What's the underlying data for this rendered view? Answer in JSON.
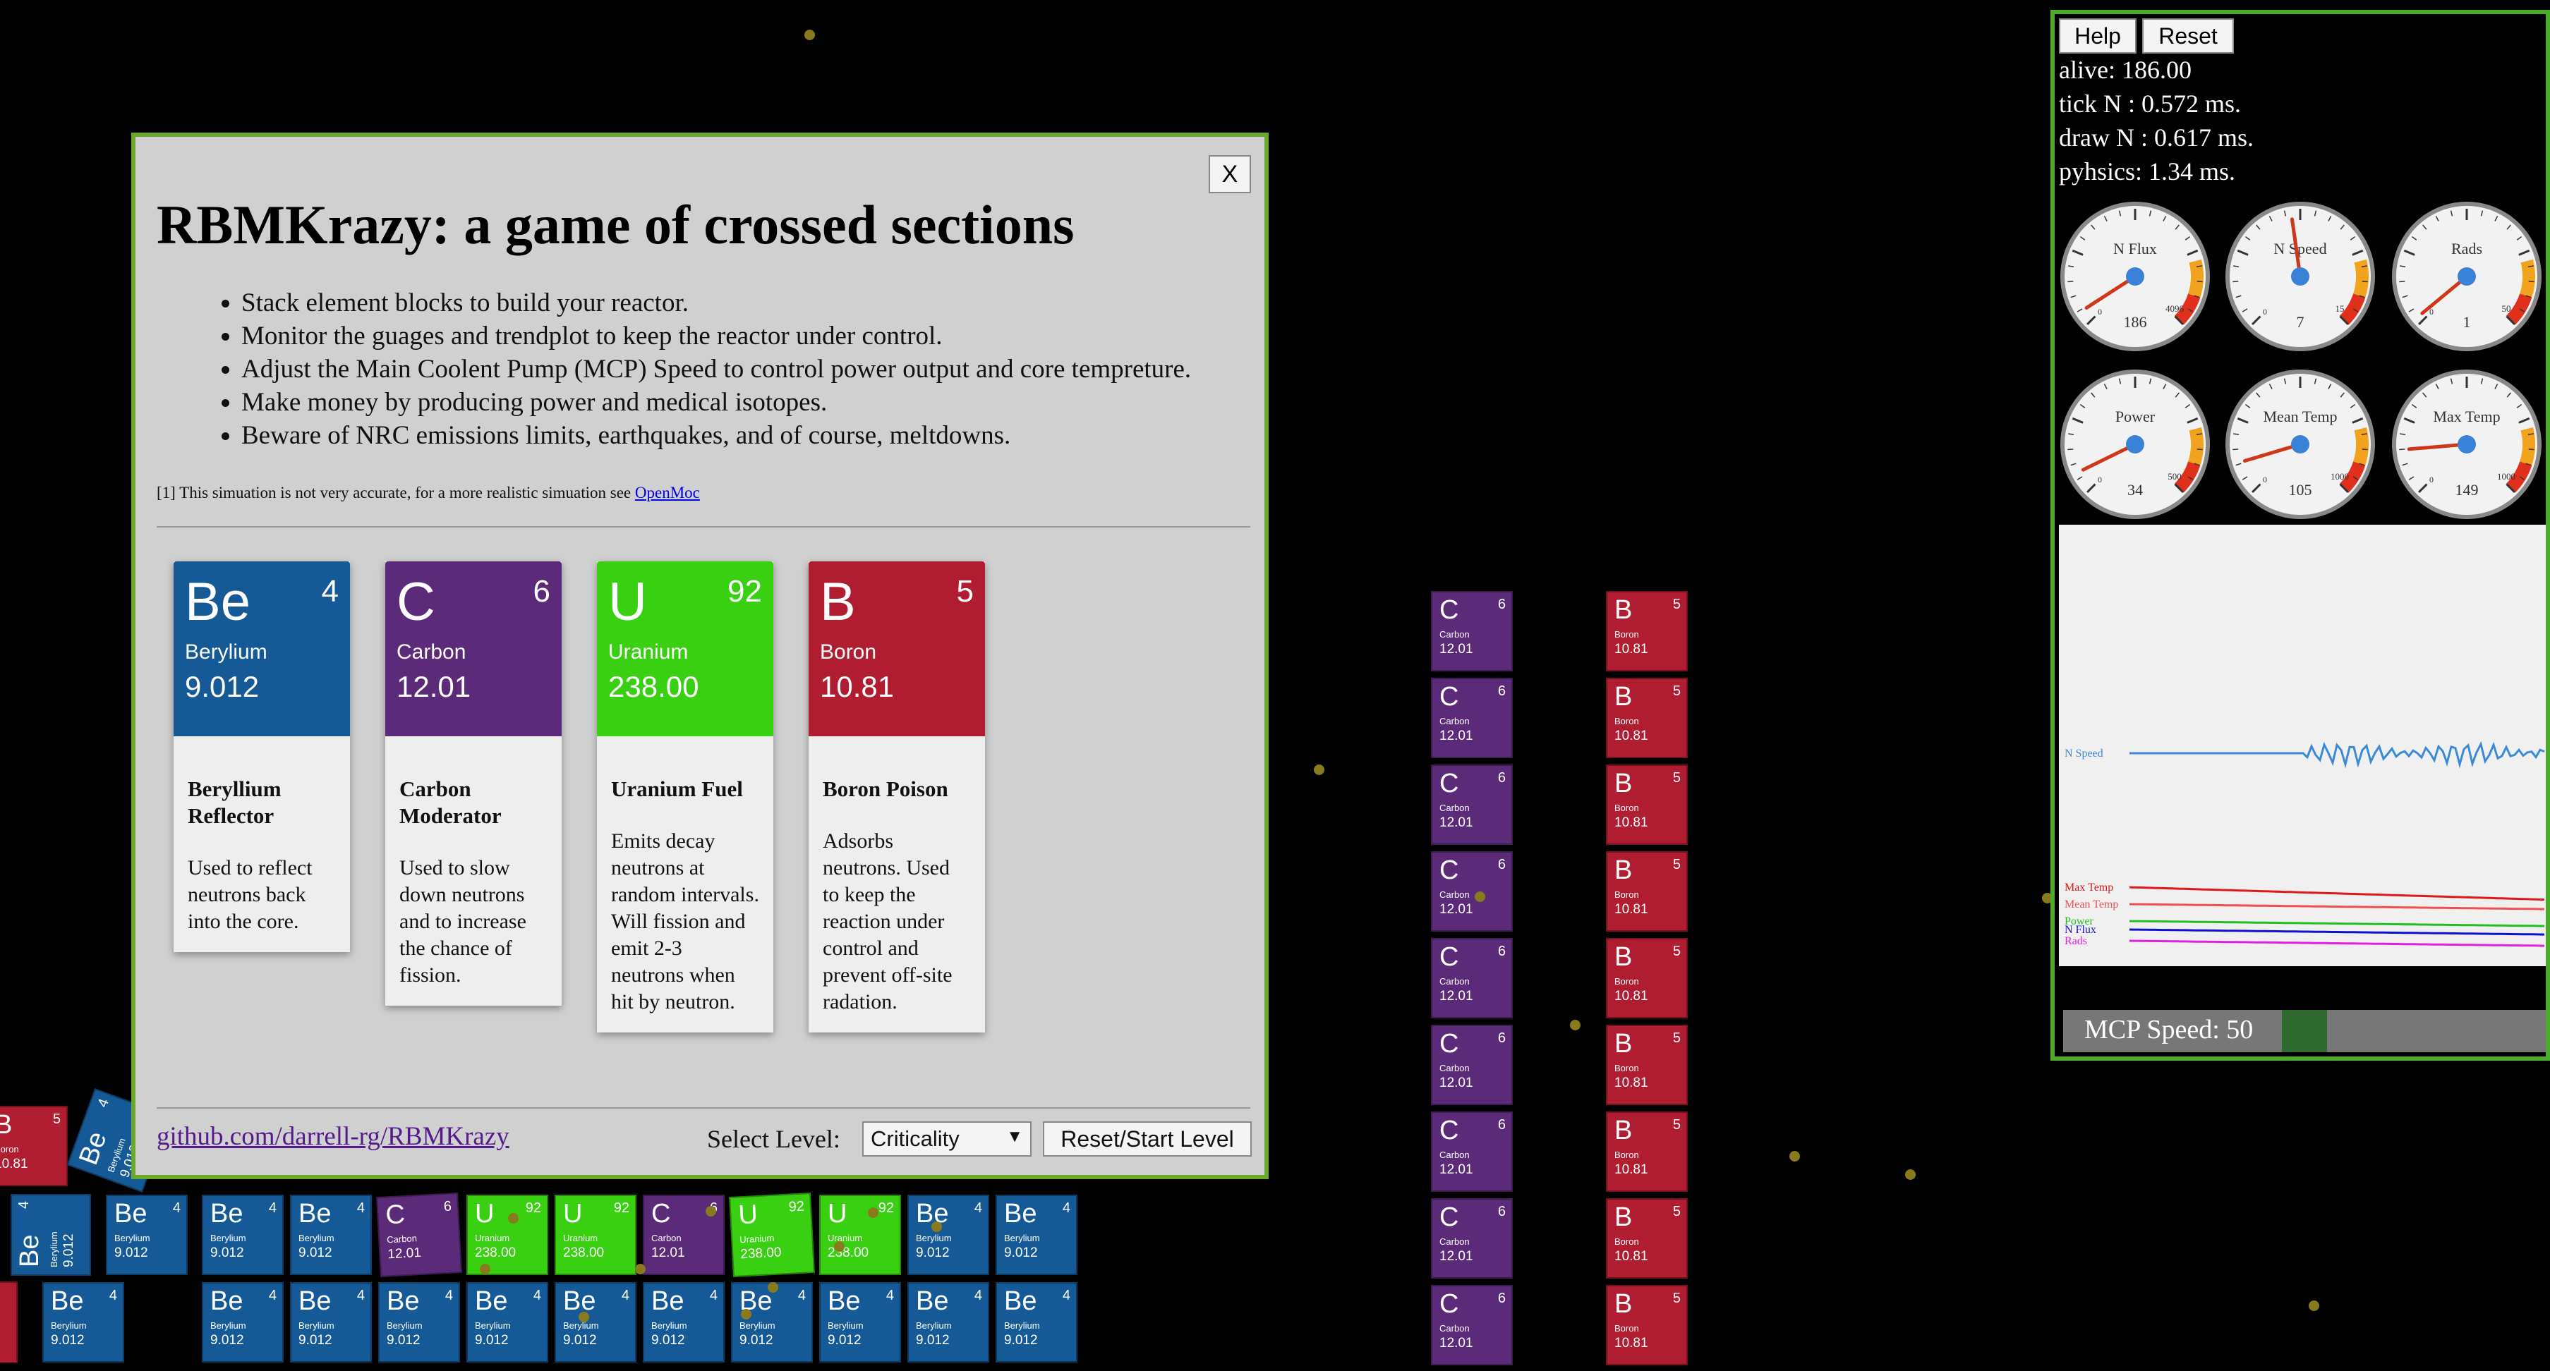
{
  "dialog": {
    "close_label": "X",
    "title": "RBMKrazy: a game of crossed sections",
    "bullets": [
      "Stack element blocks to build your reactor.",
      "Monitor the guages and trendplot to keep the reactor under control.",
      "Adjust the Main Coolent Pump (MCP) Speed to control power output and core tempreture.",
      "Make money by producing power and medical isotopes.",
      "Beware of NRC emissions limits, earthquakes, and of course, meltdowns."
    ],
    "footnote_text": "[1] This simuation is not very accurate, for a more realistic simuation see ",
    "footnote_link": "OpenMoc",
    "cards": [
      {
        "symbol": "Be",
        "number": "4",
        "name": "Berylium",
        "mass": "9.012",
        "title": "Beryllium Reflector",
        "desc": "Used to reflect neutrons back into the core.",
        "color": "#155a96"
      },
      {
        "symbol": "C",
        "number": "6",
        "name": "Carbon",
        "mass": "12.01",
        "title": "Carbon Moderator",
        "desc": "Used to slow down neutrons and to increase the chance of fission.",
        "color": "#5b2b7a"
      },
      {
        "symbol": "U",
        "number": "92",
        "name": "Uranium",
        "mass": "238.00",
        "title": "Uranium Fuel",
        "desc": "Emits decay neutrons at random intervals. Will fission and emit 2-3 neutrons when hit by neutron.",
        "color": "#3ad012"
      },
      {
        "symbol": "B",
        "number": "5",
        "name": "Boron",
        "mass": "10.81",
        "title": "Boron Poison",
        "desc": "Adsorbs neutrons. Used to keep the reaction under control and prevent off-site radation.",
        "color": "#b01c30"
      }
    ],
    "github_link": "github.com/darrell-rg/RBMKrazy",
    "select_label": "Select Level:",
    "level_value": "Criticality",
    "start_label": "Reset/Start Level"
  },
  "elements": {
    "Be": {
      "symbol": "Be",
      "number": "4",
      "name": "Berylium",
      "mass": "9.012",
      "color": "#155a96"
    },
    "C": {
      "symbol": "C",
      "number": "6",
      "name": "Carbon",
      "mass": "12.01",
      "color": "#5b2b7a"
    },
    "U": {
      "symbol": "U",
      "number": "92",
      "name": "Uranium",
      "mass": "238.00",
      "color": "#3ad012"
    },
    "B": {
      "symbol": "B",
      "number": "5",
      "name": "Boron",
      "mass": "10.81",
      "color": "#b01c30"
    }
  },
  "panel": {
    "help_label": "Help",
    "reset_label": "Reset",
    "alive": "alive: 186.00",
    "tick": "tick N : 0.572 ms.",
    "draw": "draw N : 0.617 ms.",
    "physics": "pyhsics: 1.34 ms.",
    "gauges": [
      {
        "label": "N Flux",
        "value": "186",
        "max": "4096",
        "fraction": 0.045
      },
      {
        "label": "N Speed",
        "value": "7",
        "max": "15",
        "fraction": 0.47
      },
      {
        "label": "Rads",
        "value": "1",
        "max": "50",
        "fraction": 0.02
      },
      {
        "label": "Power",
        "value": "34",
        "max": "500",
        "fraction": 0.07
      },
      {
        "label": "Mean Temp",
        "value": "105",
        "max": "1000",
        "fraction": 0.105
      },
      {
        "label": "Max Temp",
        "value": "149",
        "max": "1000",
        "fraction": 0.149
      }
    ],
    "trend_labels": [
      "N Speed",
      "Max Temp",
      "Mean Temp",
      "Power",
      "N Flux",
      "Rads"
    ],
    "mcp_label": "MCP Speed: 50",
    "mcp_value": 50
  }
}
